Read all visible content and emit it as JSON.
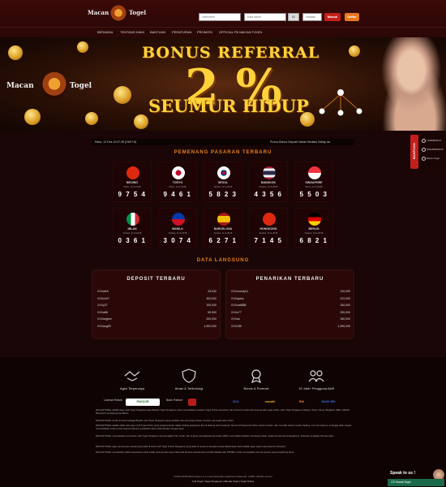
{
  "header": {
    "logo_left": "Macan",
    "logo_right": "Togel",
    "username_placeholder": "Username",
    "password_placeholder": "Kata sandi",
    "captcha_value": "52",
    "captcha_placeholder": "Validasi",
    "login_label": "Masuk",
    "register_label": "Daftar"
  },
  "nav": [
    "BERANDA",
    "TENTANG KAMI",
    "BANTUAN",
    "PERATURAN",
    "PROMOSI",
    "OFFICIAL FB MACAN TOGEL"
  ],
  "banner": {
    "title": "BONUS REFERRAL",
    "percent": "2 %",
    "subtitle": "SEUMUR HIDUP",
    "logo_left": "Macan",
    "logo_right": "Togel"
  },
  "ticker": {
    "date": "Rabu, 12 Des 10:37:28 (GMT+8)",
    "marquee": "Promo Bonus Deposit Harian Berlaku Setiap da"
  },
  "results_title": "PEMENANG PASARAN TERBARU",
  "results": [
    {
      "city": "BEIJING",
      "date": "Rabu, 12-9-2018",
      "number": "9754",
      "flag": "china"
    },
    {
      "city": "TOKYO",
      "date": "Rabu, 12-9-2018",
      "number": "9461",
      "flag": "japan"
    },
    {
      "city": "SEOUL",
      "date": "Selasa, 11-9-2018",
      "number": "5823",
      "flag": "korea"
    },
    {
      "city": "BANGKOK",
      "date": "Selasa, 11-9-2018",
      "number": "4356",
      "flag": "thailand"
    },
    {
      "city": "SINGAPORE",
      "date": "Senin, 10-9-2018",
      "number": "5503",
      "flag": "singapore"
    },
    {
      "city": "MILAN",
      "date": "Selasa, 11-9-2018",
      "number": "0361",
      "flag": "italy"
    },
    {
      "city": "MANILA",
      "date": "Selasa, 11-9-2018",
      "number": "3074",
      "flag": "philippines"
    },
    {
      "city": "BARCELONA",
      "date": "Selasa, 11-9-2018",
      "number": "6271",
      "flag": "spain"
    },
    {
      "city": "HONGKONG",
      "date": "Selasa, 11-9-2018",
      "number": "7145",
      "flag": "hongkong"
    },
    {
      "city": "BERLIN",
      "date": "Selasa, 11-9-2018",
      "number": "6821",
      "flag": "germany"
    }
  ],
  "live_title": "DATA LANGSUNG",
  "deposit": {
    "title": "DEPOSIT TERBARU",
    "rows": [
      {
        "name": "XXXal18",
        "amount": "25,000"
      },
      {
        "name": "XXXn347",
        "amount": "300,000"
      },
      {
        "name": "XXXy27",
        "amount": "100,000"
      },
      {
        "name": "XXXa86",
        "amount": "50,000"
      },
      {
        "name": "XXXanjyem",
        "amount": "200,000"
      },
      {
        "name": "XXXaxg99",
        "amount": "1,500,000"
      }
    ]
  },
  "withdraw": {
    "title": "PENARIKAN TERBARU",
    "rows": [
      {
        "name": "XXXomedy11",
        "amount": "120,000"
      },
      {
        "name": "XXXaptos",
        "amount": "222,000"
      },
      {
        "name": "XXXuati888",
        "amount": "150,000"
      },
      {
        "name": "XXXn77",
        "amount": "250,000"
      },
      {
        "name": "XXXan",
        "amount": "150,000"
      },
      {
        "name": "XXX185",
        "amount": "1,306,000"
      }
    ]
  },
  "side": {
    "tab_label": "BANTUAN",
    "phone": "+6285809XXX",
    "wa": "6281380500XXX",
    "line": "Macan Togel"
  },
  "features": [
    "Agen Terpercaya",
    "Aman & Terlindungi",
    "Bonus & Promosi",
    "10 Juta+ Pengguna Aktif"
  ],
  "partners": {
    "license_label": "License Resmi",
    "pagcor": "PAGCOR",
    "bank_label": "Bank Partner",
    "banks": [
      "BCA",
      "mandiri",
      "BNI",
      "BANK BRI"
    ]
  },
  "paragraphs": [
    "MACANTOGEL adalah Agen Judi Togel Singapura atau Bandar Togel Singapore yang menyediakan pasaran Togel Online terpopuler dan ramai di minati oleh para pemain togel online, yaitu Togel Singapura, Beijing, Tokyo, Seoul, Bangkok, Milan, Manila, Barcelona, Hongkong dan Berlin.",
    "MACANTOGEL sudah di kenal sebagai Bandar Judi Togel Singapura yang terdaftar dan di percaya ribuan member nya sejak tahun 2013",
    "MACANTOGEL adalah salah satu Agen Judi Togel Online yang sangat populer dalam bidang pelayanan dan di dukung oleh Costumer Service Profesional Online selama 24 jam, dan memiliki sarana media chatting, sms dan telepon, sehingga akan sangat memudahkan untuk proses deposit ataupun penarikan dana anda dengan sangat cepat.",
    "MACANTOGEL menyediakan permainan Judi Togel Singapura yang lengkap! Fair, Aman, dan di jamin pembayarannya selalu 100%, serta tidak terbatas membayar jutaan rupiah pemain kemenangannya. Keluaran Lengkap! Periode data ...",
    "MACANTOGEL juga mempunyai reputasi yang baik di dunia Judi Togel Online Singapura yang telah di review di banyak tempat dikarenakan kami adalah agen togel terpercaya di Indonesia.",
    "MACANTOGEL memberikan pilihan kepuasan untuk setiap para pemain togel Indonesia dimana website kita memiliki fasilitas dan PROMO untuk memanjakan semua pemain yang bergabung disini."
  ],
  "copyright": "©2013-2018 MacanTogel | is an internationally registered trademark. | RMP | Mobile version",
  "footer_links": "Judi Togel | Togel Singapura | Bandar Togel | Togel Online",
  "chat": {
    "status": "Speak to us !",
    "name": "CS MacanTogel"
  }
}
